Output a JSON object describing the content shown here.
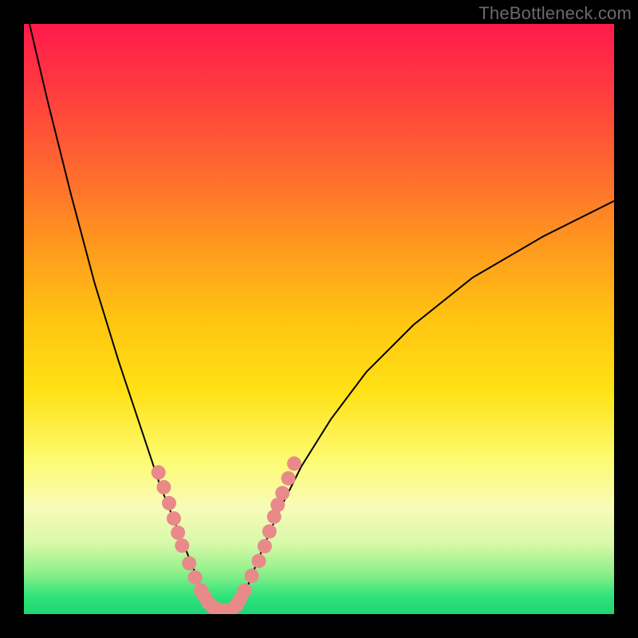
{
  "watermark": {
    "text": "TheBottleneck.com"
  },
  "colors": {
    "background": "#000000",
    "curve": "#000000",
    "dots": "#e88a8a",
    "gradient_top": "#ff1a4b",
    "gradient_bottom": "#1fd574"
  },
  "chart_data": {
    "type": "line",
    "title": "",
    "xlabel": "",
    "ylabel": "",
    "xlim": [
      0,
      100
    ],
    "ylim": [
      0,
      100
    ],
    "grid": false,
    "series": [
      {
        "name": "bottleneck-curve",
        "x": [
          0,
          4,
          8,
          12,
          16,
          20,
          23,
          25,
          27,
          29,
          30,
          31,
          32,
          33,
          34,
          35,
          36,
          38,
          40,
          43,
          47,
          52,
          58,
          66,
          76,
          88,
          100
        ],
        "y": [
          104,
          87,
          71,
          56,
          43,
          31,
          22,
          17,
          12,
          7,
          4,
          2,
          1,
          0.5,
          0.5,
          1,
          2,
          5,
          10,
          17,
          25,
          33,
          41,
          49,
          57,
          64,
          70
        ]
      }
    ],
    "highlight_points": {
      "name": "dot-cluster",
      "x": [
        22.8,
        23.7,
        24.6,
        25.4,
        26.1,
        26.8,
        28.0,
        29.0,
        30.0,
        30.6,
        31.2,
        32.0,
        32.8,
        33.6,
        34.4,
        35.2,
        36.0,
        36.6,
        37.4,
        38.6,
        39.8,
        40.8,
        41.6,
        42.4,
        43.0,
        43.8,
        44.8,
        45.8
      ],
      "y": [
        24.0,
        21.5,
        18.8,
        16.2,
        13.8,
        11.6,
        8.6,
        6.2,
        4.0,
        3.0,
        2.0,
        1.2,
        0.8,
        0.6,
        0.6,
        0.8,
        1.5,
        2.5,
        4.0,
        6.5,
        9.0,
        11.5,
        14.0,
        16.5,
        18.5,
        20.5,
        23.0,
        25.5
      ]
    }
  }
}
